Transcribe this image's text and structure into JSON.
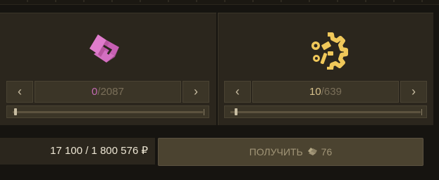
{
  "left_resource": {
    "icon": "pink-crate-icon",
    "current": "0",
    "separator": "/",
    "max": "2087",
    "prev_icon": "‹",
    "next_icon": "›",
    "slider_fraction": 0
  },
  "right_resource": {
    "icon": "gold-gear-parts-icon",
    "current": "10",
    "separator": "/",
    "max": "639",
    "prev_icon": "‹",
    "next_icon": "›",
    "slider_fraction": 0.016
  },
  "total": {
    "text": "17 100 / 1 800 576 ₽"
  },
  "get_button": {
    "label": "ПОЛУЧИТЬ",
    "count": "76",
    "icon": "crate-icon"
  },
  "colors": {
    "pink": "#c46bb3",
    "gold": "#f0c85a"
  }
}
